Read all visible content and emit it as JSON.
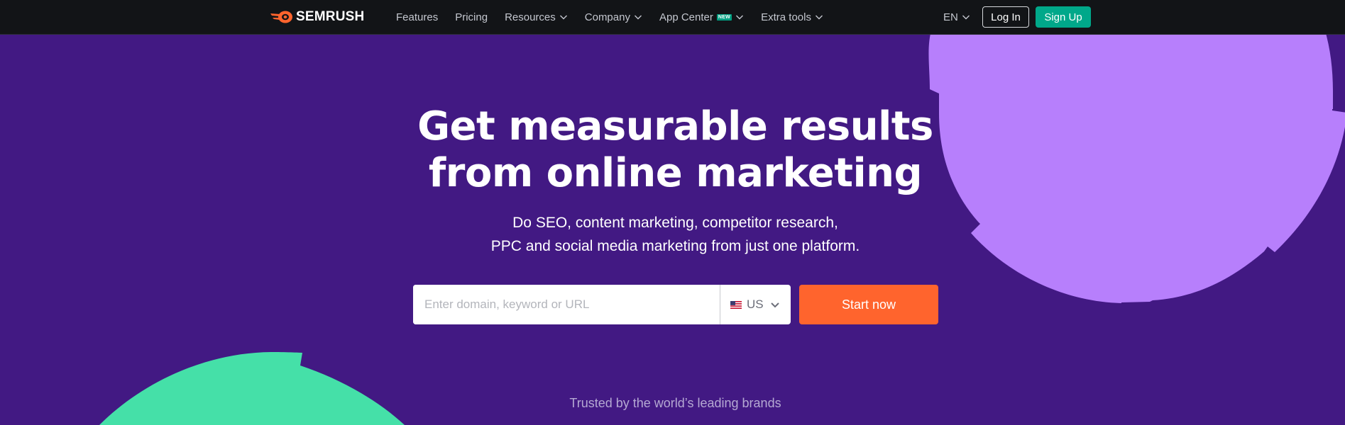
{
  "brand": {
    "name": "SEMRUSH",
    "accent": "#ff642d"
  },
  "nav": {
    "items": [
      {
        "label": "Features",
        "has_dropdown": false
      },
      {
        "label": "Pricing",
        "has_dropdown": false
      },
      {
        "label": "Resources",
        "has_dropdown": true
      },
      {
        "label": "Company",
        "has_dropdown": true
      },
      {
        "label": "App Center",
        "has_dropdown": true,
        "badge": "NEW"
      },
      {
        "label": "Extra tools",
        "has_dropdown": true
      }
    ],
    "language": "EN",
    "login_label": "Log In",
    "signup_label": "Sign Up"
  },
  "hero": {
    "title_line1": "Get measurable results",
    "title_line2": "from online marketing",
    "subtitle_line1": "Do SEO, content marketing, competitor research,",
    "subtitle_line2": "PPC and social media marketing from just one platform.",
    "search_placeholder": "Enter domain, keyword or URL",
    "database": "US",
    "database_flag_icon": "us-flag-icon",
    "cta_label": "Start now"
  },
  "trusted_text": "Trusted by the world’s leading brands",
  "colors": {
    "background": "#421983",
    "topbar": "#121417",
    "signup": "#00a88a",
    "cta": "#ff642d",
    "deco_purple": "#b77ffc",
    "deco_green": "#45e0a8"
  }
}
